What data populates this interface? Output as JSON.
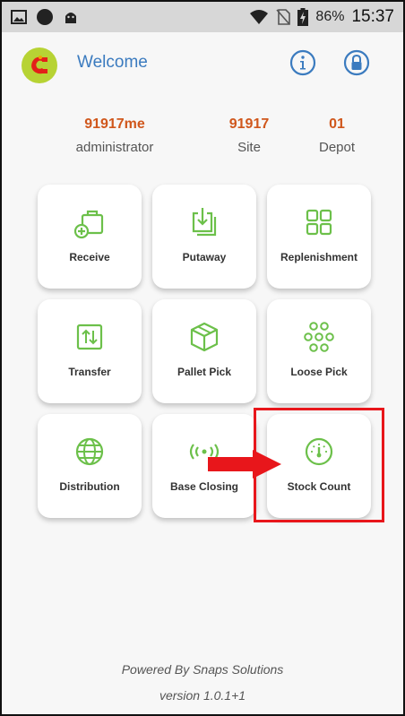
{
  "status_bar": {
    "battery_percent": "86%",
    "time": "15:37"
  },
  "header": {
    "title": "Welcome"
  },
  "user_info": [
    {
      "value": "91917me",
      "label": "administrator"
    },
    {
      "value": "91917",
      "label": "Site"
    },
    {
      "value": "01",
      "label": "Depot"
    }
  ],
  "tiles": [
    {
      "label": "Receive",
      "icon": "receive-icon"
    },
    {
      "label": "Putaway",
      "icon": "putaway-icon"
    },
    {
      "label": "Replenishment",
      "icon": "grid-icon"
    },
    {
      "label": "Transfer",
      "icon": "transfer-icon"
    },
    {
      "label": "Pallet Pick",
      "icon": "box-icon"
    },
    {
      "label": "Loose Pick",
      "icon": "loose-pick-icon"
    },
    {
      "label": "Distribution",
      "icon": "globe-icon"
    },
    {
      "label": "Base Closing",
      "icon": "signal-icon"
    },
    {
      "label": "Stock Count",
      "icon": "gauge-icon"
    }
  ],
  "footer": {
    "powered_by": "Powered By Snaps Solutions",
    "version": "version 1.0.1+1"
  },
  "colors": {
    "accent_green": "#6cc04a",
    "header_blue": "#3b7bbf",
    "value_orange": "#d0571c",
    "highlight_red": "#e8161b"
  }
}
